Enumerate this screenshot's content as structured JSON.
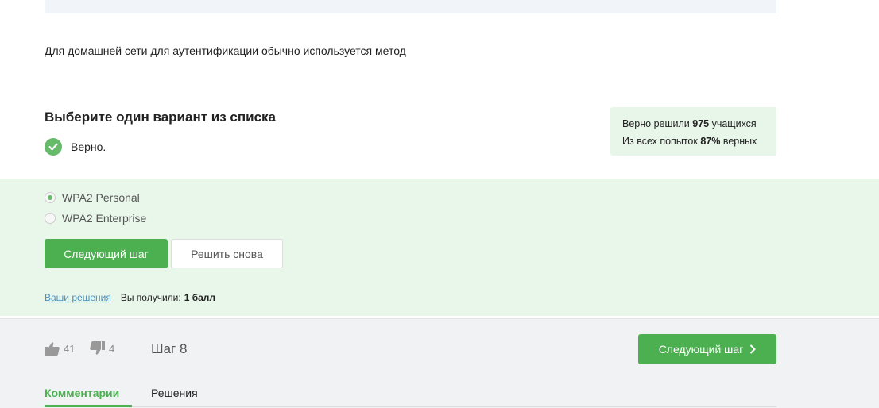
{
  "question": {
    "text": "Для домашней сети для аутентификации обычно используется метод"
  },
  "task": {
    "title": "Выберите один вариант из списка",
    "result_text": "Верно."
  },
  "stats": {
    "line1_prefix": "Верно решили",
    "line1_count": "975",
    "line1_suffix": "учащихся",
    "line2_prefix": "Из всех попыток",
    "line2_percent": "87%",
    "line2_suffix": "верных"
  },
  "options": [
    {
      "label": "WPA2 Personal",
      "checked": true
    },
    {
      "label": "WPA2 Enterprise",
      "checked": false
    }
  ],
  "buttons": {
    "next_step": "Следующий шаг",
    "retry": "Решить снова"
  },
  "solutions": {
    "link": "Ваши решения",
    "score_label": "Вы получили:",
    "score_value": "1 балл"
  },
  "footer": {
    "likes": "41",
    "dislikes": "4",
    "step_label": "Шаг 8",
    "next_step": "Следующий шаг",
    "tabs": [
      "Комментарии",
      "Решения"
    ],
    "active_tab": "Комментарии"
  },
  "colors": {
    "accent_green": "#4caf50",
    "light_green_bg": "#e9f6ea",
    "link_blue": "#4a90c2"
  }
}
